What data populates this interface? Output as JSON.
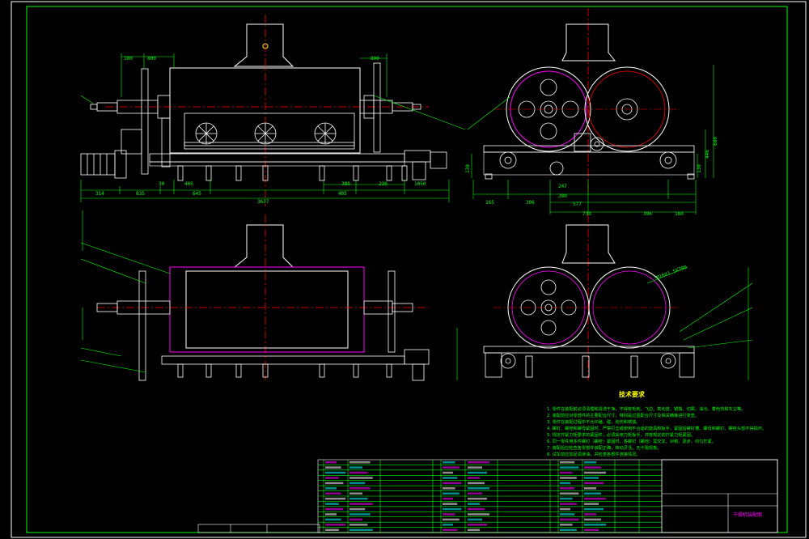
{
  "front_view": {
    "dims_top": [
      "180",
      "800",
      "800"
    ],
    "dims_bottom": [
      "314",
      "835",
      "30",
      "405",
      "645",
      "380",
      "230",
      "405",
      "1050",
      "3637"
    ]
  },
  "side_view": {
    "dims_bottom": [
      "165",
      "396",
      "247",
      "280",
      "577",
      "733",
      "396",
      "160"
    ],
    "dims_left": [
      "130"
    ],
    "dims_right": [
      "130",
      "446",
      "680"
    ]
  },
  "lower_side_view": {
    "leader_label": "M16X1.5X790"
  },
  "notes": {
    "title": "技术要求",
    "lines": [
      "1. 零件在装配前必须清理和清洗干净，不得有毛刺、飞边、氧化皮、锈蚀、切屑、油污、着色剂和灰尘等。",
      "2. 装配前应对零部件的主要配合尺寸，特别是过盈配合尺寸及相关精度进行复查。",
      "3. 零件在装配过程中不允许磕、碰、划伤和锈蚀。",
      "4. 螺钉、螺栓和螺母紧固时，严禁打击或使用不合适的旋具和扳手，紧固后螺钉槽、螺母和螺钉、螺栓头部不得损坏。",
      "5. 规定拧紧力矩要求的紧固件，必须采用力矩扳手，并按规定的拧紧力矩紧固。",
      "6. 同一零件用多件螺钉（螺栓）紧固时，各螺钉（螺栓）需交叉、对称、逐步、均匀拧紧。",
      "7. 装配后应检查各零部件装配正确，转动灵活，无卡阻现象。",
      "8. 试车前应加足润滑油，并检查各部件连接情况。"
    ]
  },
  "title_block": {
    "drawing_title": "干燥机装配图"
  },
  "colors": {
    "background": "#000000",
    "outline": "#ffffff",
    "dimension": "#00ff00",
    "centerline": "#ff0000",
    "accent": "#ff00ff",
    "hidden": "#00ffff",
    "yellow": "#ffff00"
  }
}
